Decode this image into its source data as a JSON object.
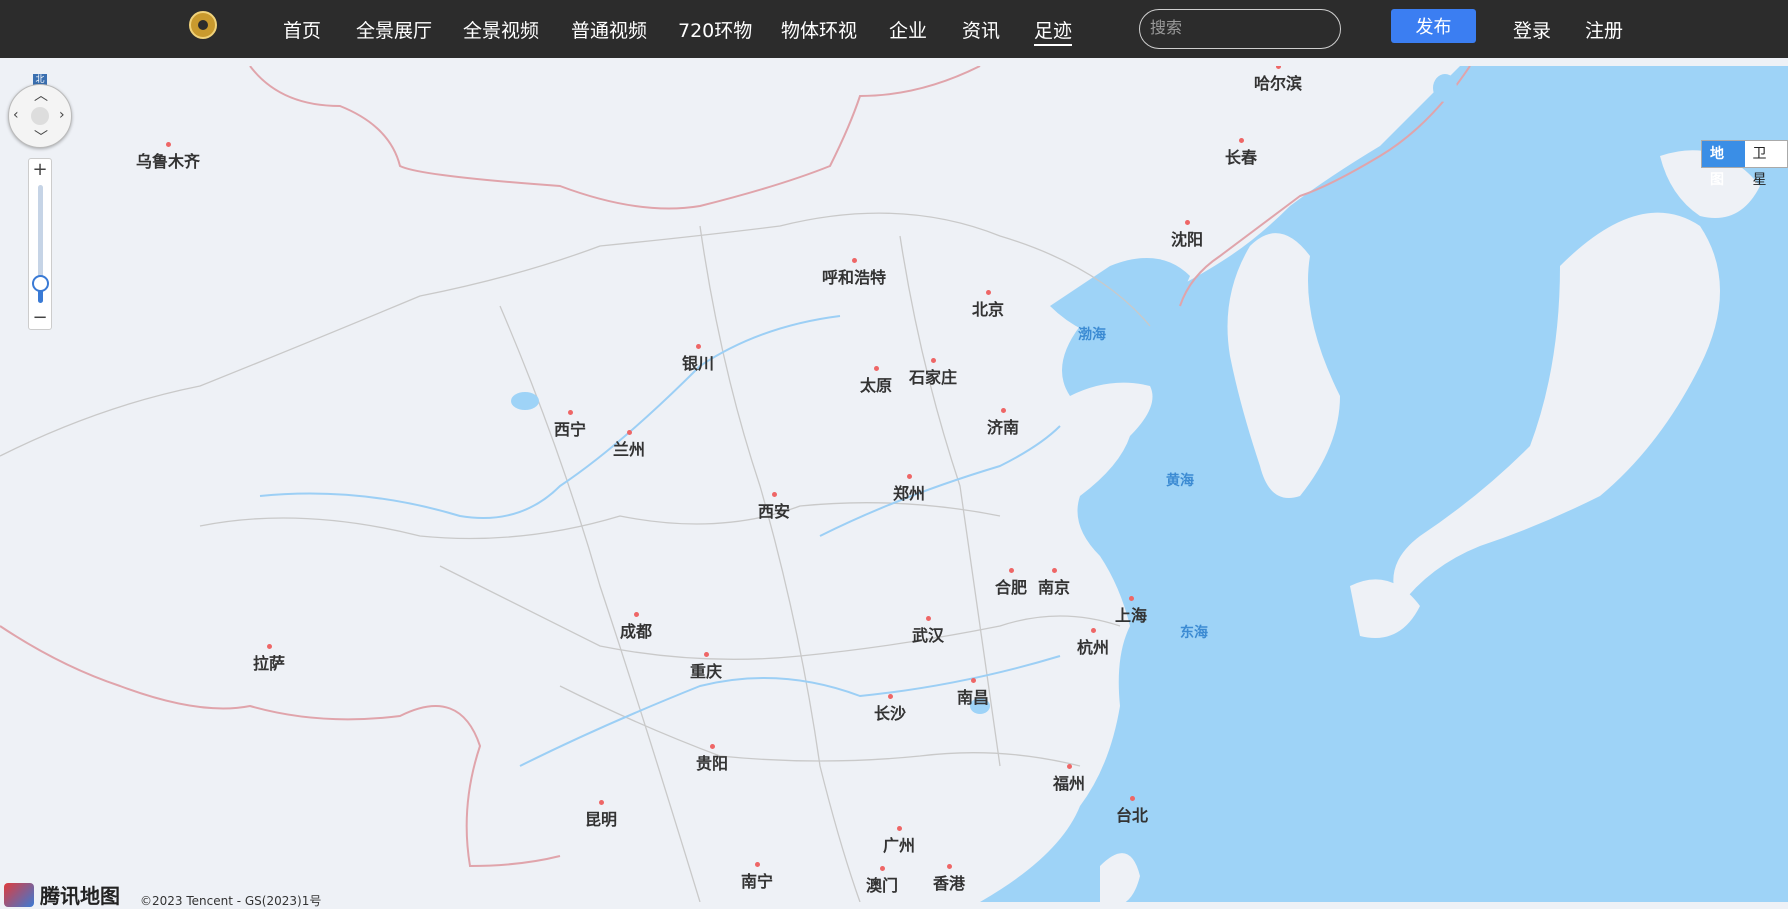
{
  "header": {
    "nav": [
      {
        "label": "首页"
      },
      {
        "label": "全景展厅"
      },
      {
        "label": "全景视频"
      },
      {
        "label": "普通视频"
      },
      {
        "label": "720环物"
      },
      {
        "label": "物体环视"
      },
      {
        "label": "企业"
      },
      {
        "label": "资讯"
      },
      {
        "label": "足迹"
      }
    ],
    "search_placeholder": "搜索",
    "publish_label": "发布",
    "login_label": "登录",
    "register_label": "注册"
  },
  "map": {
    "north_label": "北",
    "zoom_in": "+",
    "zoom_out": "−",
    "zoom_level_fraction": 0.15,
    "type_map": "地图",
    "type_satellite": "卫星",
    "brand": "腾讯地图",
    "copyright": "©2023 Tencent - GS(2023)1号",
    "cities": [
      "哈尔滨",
      "乌鲁木齐",
      "长春",
      "沈阳",
      "呼和浩特",
      "北京",
      "银川",
      "太原",
      "石家庄",
      "西宁",
      "兰州",
      "济南",
      "西安",
      "郑州",
      "合肥",
      "南京",
      "上海",
      "成都",
      "武汉",
      "杭州",
      "拉萨",
      "重庆",
      "南昌",
      "长沙",
      "贵阳",
      "福州",
      "台北",
      "昆明",
      "广州",
      "南宁",
      "澳门",
      "香港"
    ],
    "seas": [
      "渤海",
      "黄海",
      "东海"
    ]
  }
}
